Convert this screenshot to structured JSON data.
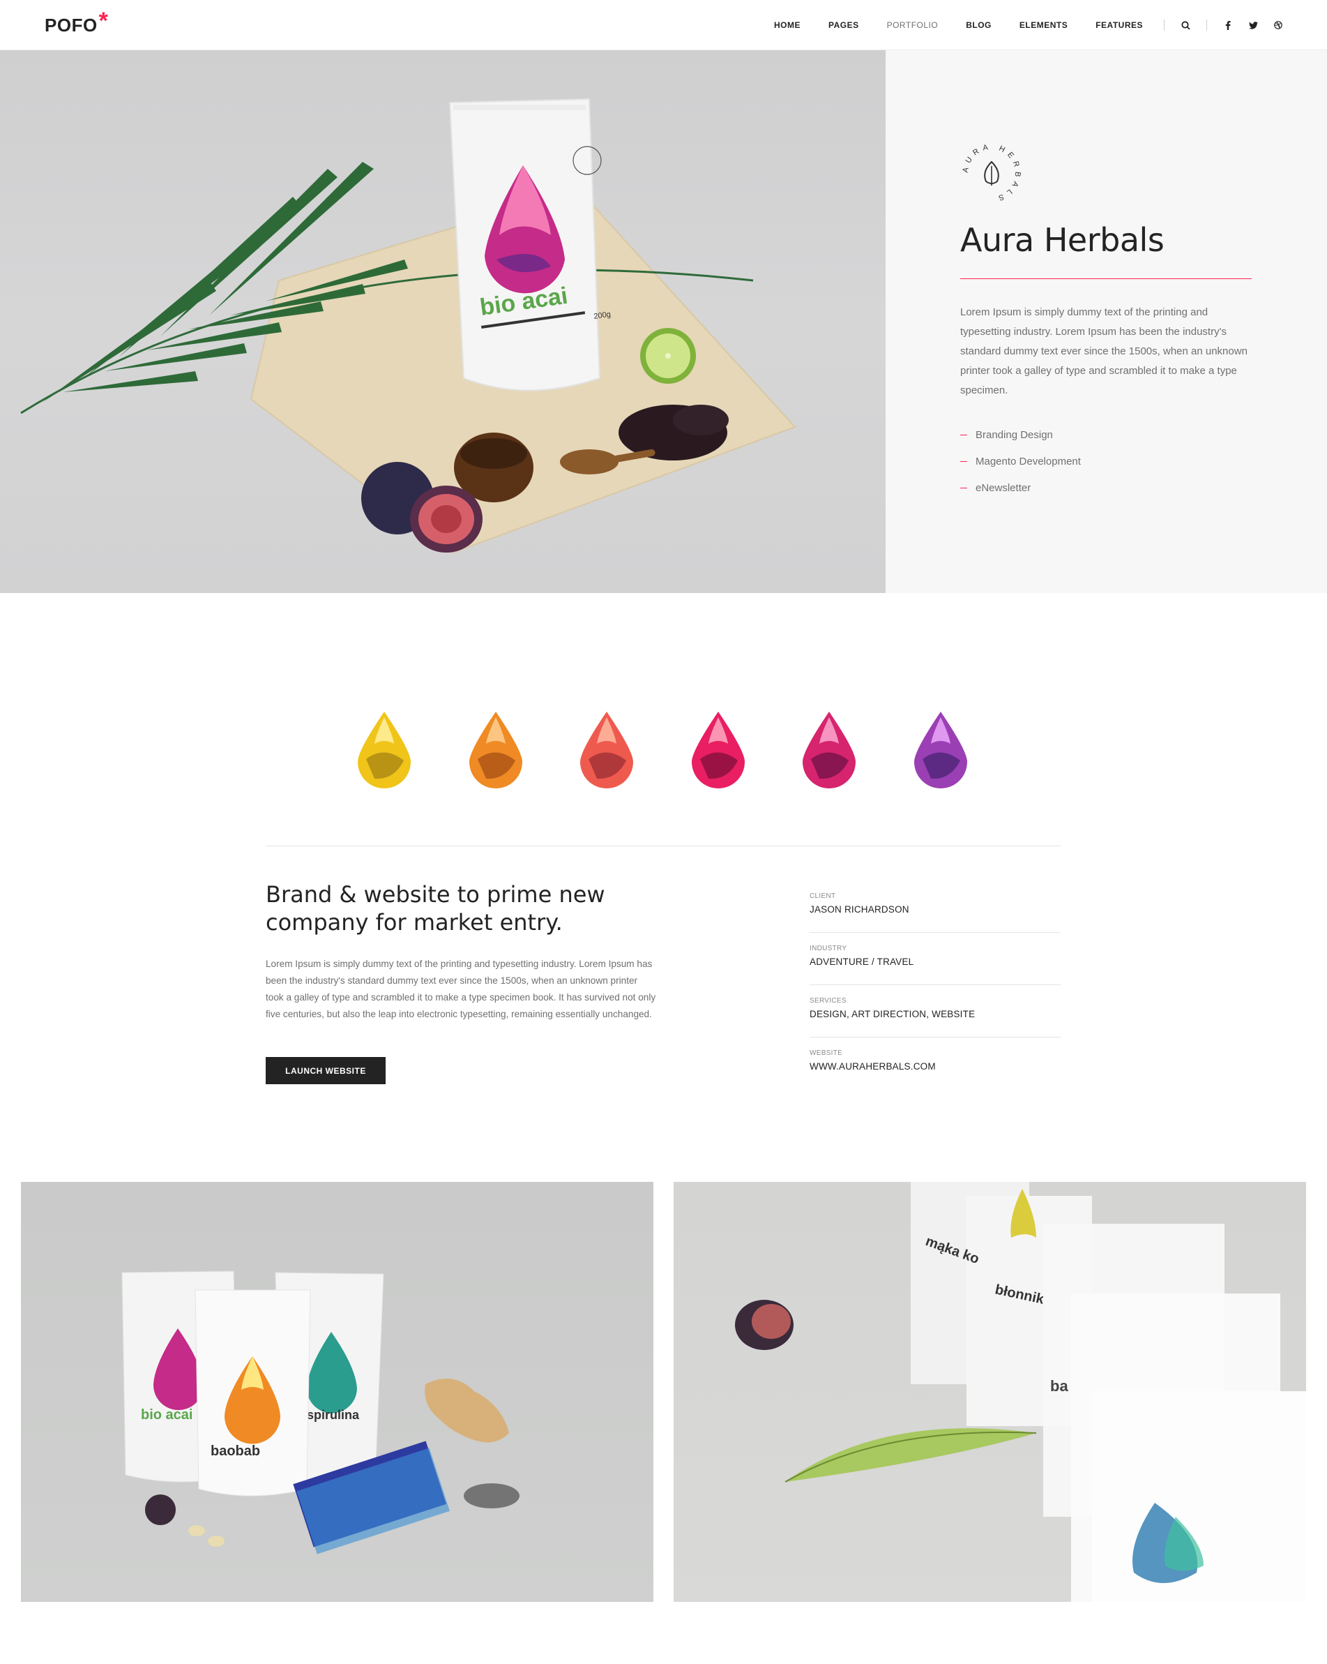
{
  "header": {
    "logo_text": "POFO",
    "logo_mark": "*",
    "nav": [
      "HOME",
      "PAGES",
      "PORTFOLIO",
      "BLOG",
      "ELEMENTS",
      "FEATURES"
    ],
    "active_nav": "PORTFOLIO",
    "icons": [
      "search-icon",
      "facebook-icon",
      "twitter-icon",
      "dribbble-icon"
    ]
  },
  "hero": {
    "package_brand": "bio acai",
    "package_weight": "200g",
    "seal_text": "AURA HERBALS",
    "title": "Aura Herbals",
    "description": "Lorem Ipsum is simply dummy text of the printing and typesetting industry. Lorem Ipsum has been the industry's standard dummy text ever since the 1500s, when an unknown printer took a galley of type and scrambled it to make a type specimen.",
    "services": [
      "Branding Design",
      "Magento Development",
      "eNewsletter"
    ]
  },
  "colors": {
    "accent": "#ff214f",
    "dark": "#232323",
    "muted": "#6f6f6f",
    "panel": "#f7f7f7",
    "drops": [
      "#f0c419",
      "#f08a24",
      "#ef5a4f",
      "#e91e63",
      "#d6246e",
      "#9b3fb5"
    ]
  },
  "project": {
    "title_line1": "Brand & website to prime new",
    "title_line2": "company for market entry.",
    "description": "Lorem Ipsum is simply dummy text of the printing and typesetting industry. Lorem Ipsum has been the industry's standard dummy text ever since the 1500s, when an unknown printer took a galley of type and scrambled it to make a type specimen book. It has survived not only five centuries, but also the leap into electronic typesetting, remaining essentially unchanged.",
    "button": "LAUNCH WEBSITE",
    "meta": [
      {
        "label": "CLIENT",
        "value": "JASON RICHARDSON"
      },
      {
        "label": "INDUSTRY",
        "value": "ADVENTURE / TRAVEL"
      },
      {
        "label": "SERVICES",
        "value": "DESIGN, ART DIRECTION, WEBSITE"
      },
      {
        "label": "WEBSITE",
        "value": "WWW.AURAHERBALS.COM"
      }
    ]
  },
  "gallery": {
    "packages_left": [
      "bio acai",
      "baobab",
      "spirulina"
    ],
    "packages_right": [
      "mąka ko",
      "błonnik",
      "ba"
    ]
  }
}
